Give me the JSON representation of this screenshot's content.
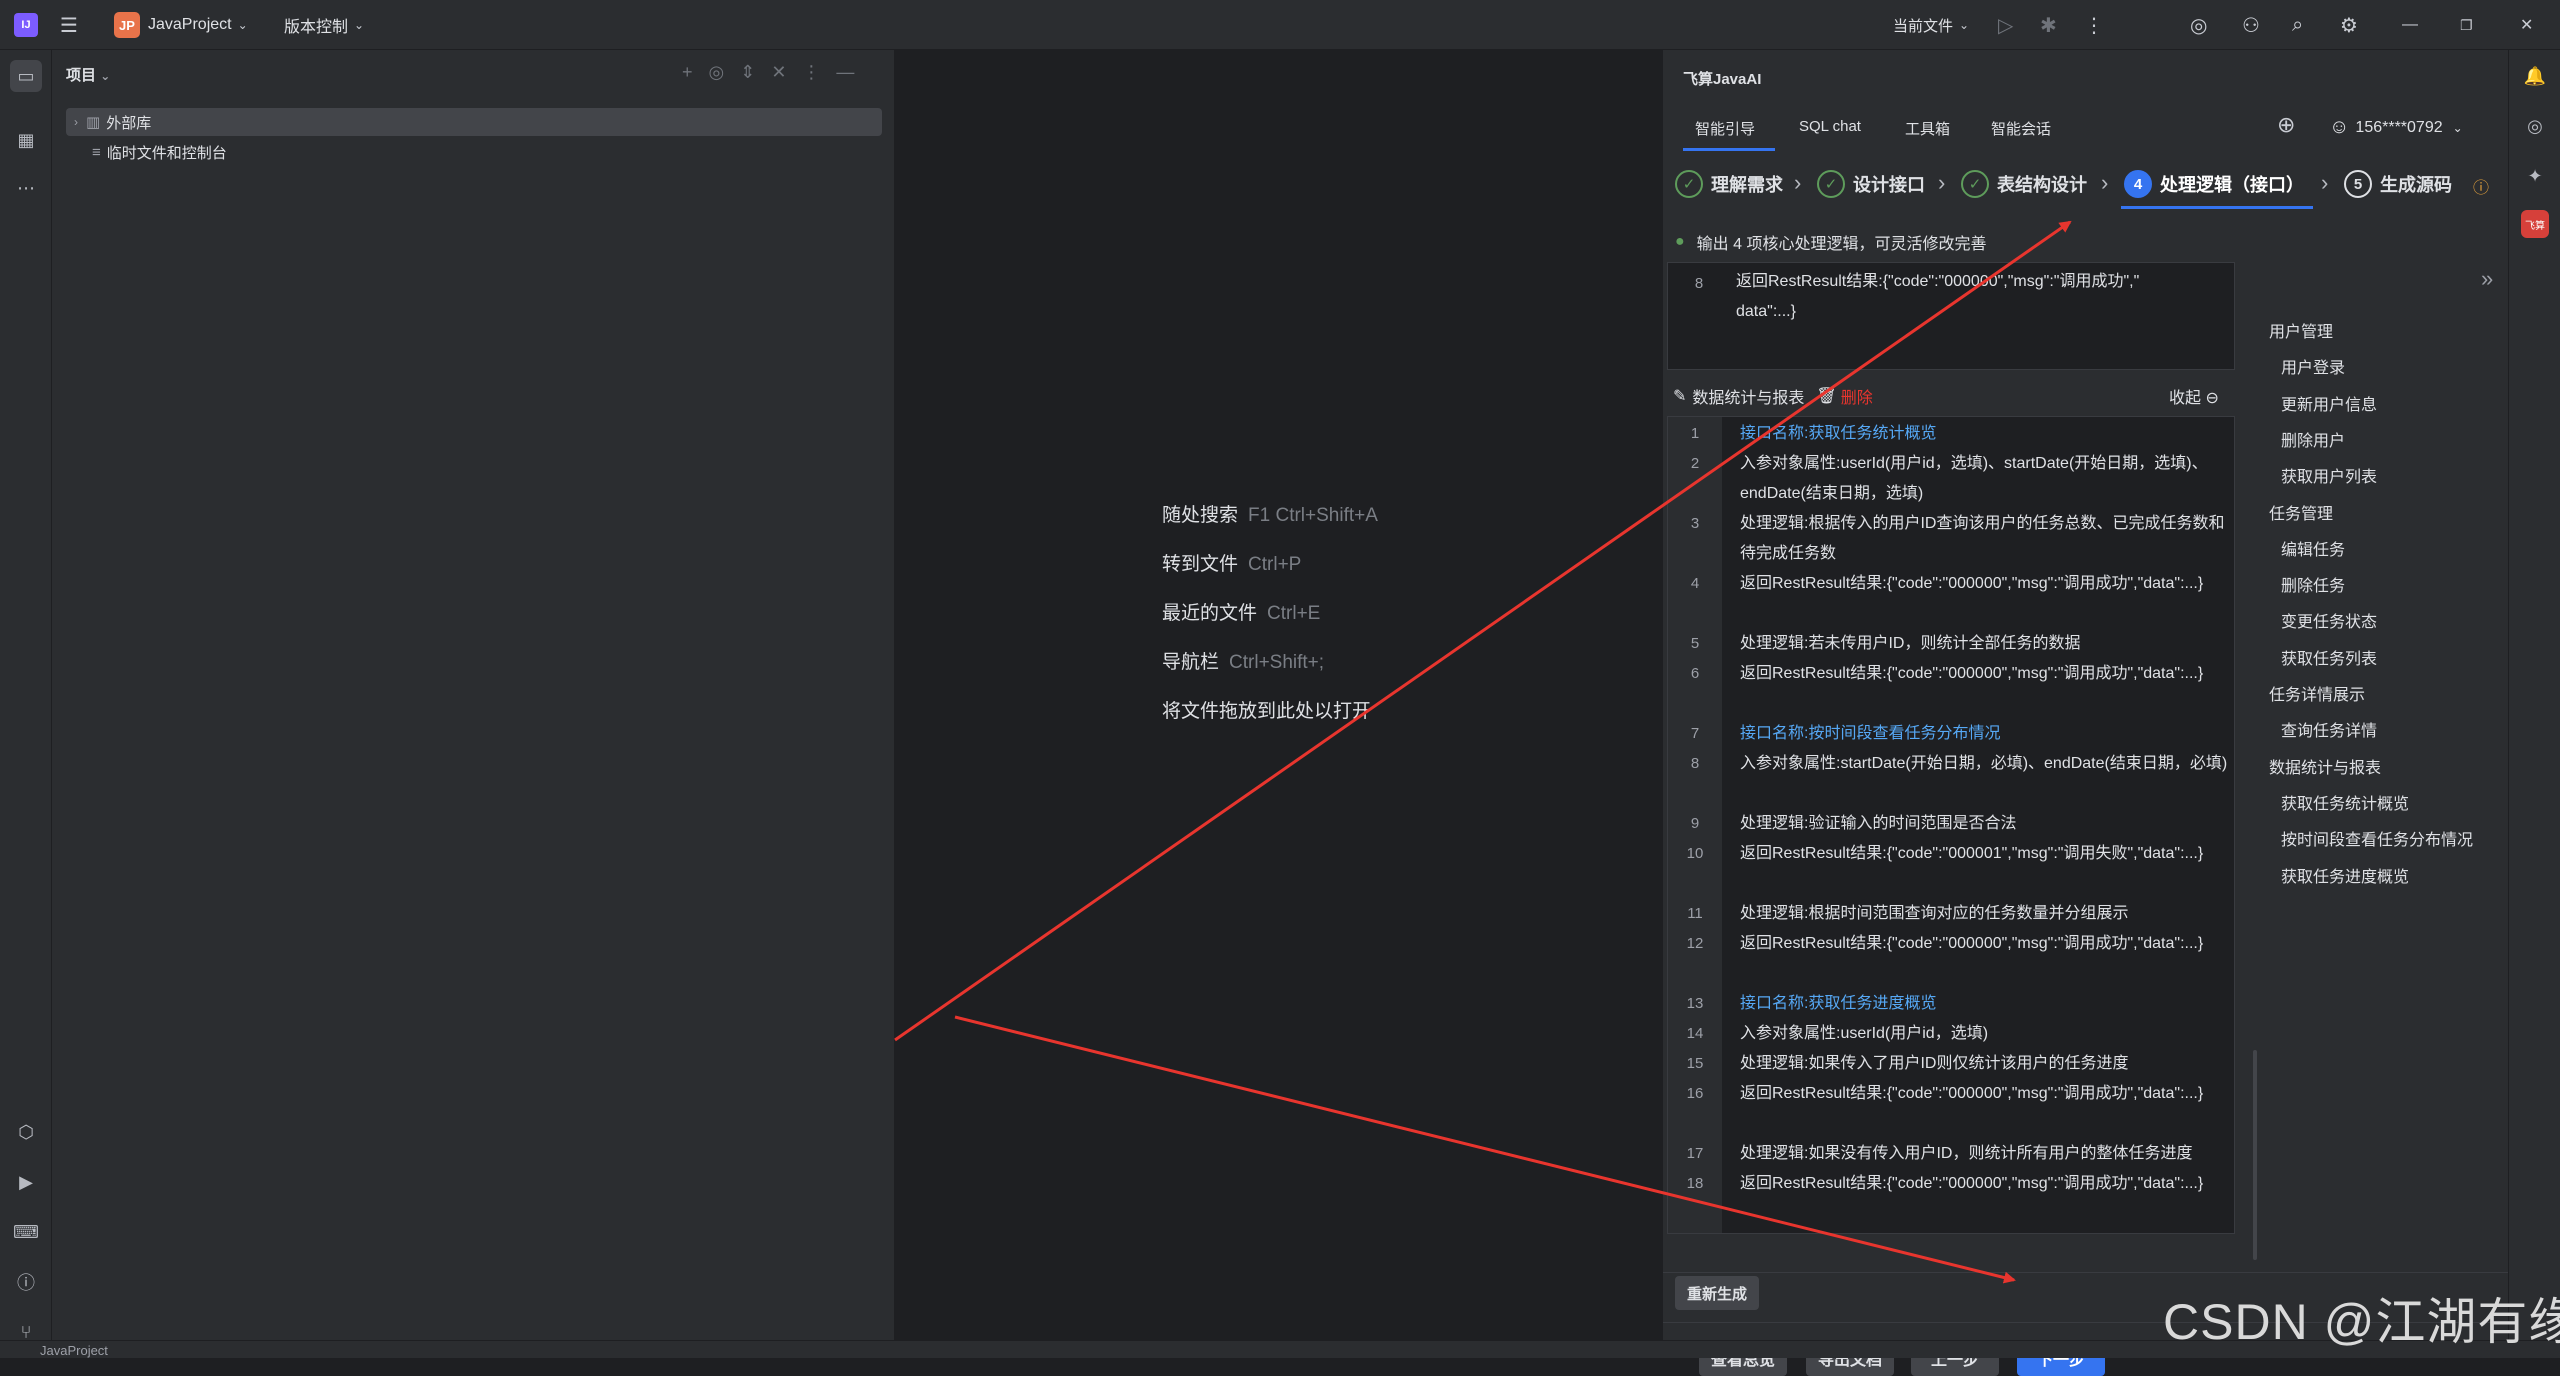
{
  "titlebar": {
    "logo": "IJ",
    "project_badge": "JP",
    "project_name": "JavaProject",
    "vcs_label": "版本控制",
    "run_config": "当前文件",
    "colors": {
      "badge": "#e8734a"
    }
  },
  "project_panel": {
    "title": "项目",
    "tree": [
      {
        "label": "外部库",
        "icon": "library-icon"
      },
      {
        "label": "临时文件和控制台",
        "icon": "scratch-icon"
      }
    ]
  },
  "editor": {
    "hints": [
      {
        "label": "随处搜索",
        "key": "F1 Ctrl+Shift+A"
      },
      {
        "label": "转到文件",
        "key": "Ctrl+P"
      },
      {
        "label": "最近的文件",
        "key": "Ctrl+E"
      },
      {
        "label": "导航栏",
        "key": "Ctrl+Shift+;"
      },
      {
        "label": "将文件拖放到此处以打开",
        "key": ""
      }
    ]
  },
  "plugin": {
    "title": "飞算JavaAI",
    "tabs": [
      "智能引导",
      "SQL chat",
      "工具箱",
      "智能会话"
    ],
    "account": "156****0792",
    "steps": [
      {
        "label": "理解需求",
        "state": "done"
      },
      {
        "label": "设计接口",
        "state": "done"
      },
      {
        "label": "表结构设计",
        "state": "done"
      },
      {
        "num": "4",
        "label": "处理逻辑（接口）",
        "state": "active"
      },
      {
        "num": "5",
        "label": "生成源码",
        "state": "todo"
      }
    ],
    "status_msg": "输出 4 项核心处理逻辑，可灵活修改完善",
    "prev_block": {
      "line_num": "8",
      "lines": [
        "返回RestResult结果:{\"code\":\"000000\",\"msg\":\"调用成功\",\"",
        "data\":...}"
      ]
    },
    "section": {
      "title": "数据统计与报表",
      "delete_label": "删除",
      "collapse_label": "收起"
    },
    "code_lines": [
      {
        "n": "1",
        "text": "接口名称:获取任务统计概览",
        "blue": true,
        "rows": 1
      },
      {
        "n": "2",
        "text": "入参对象属性:userId(用户id，选填)、startDate(开始日期，选填)、endDate(结束日期，选填)",
        "blue": false,
        "rows": 2
      },
      {
        "n": "3",
        "text": "处理逻辑:根据传入的用户ID查询该用户的任务总数、已完成任务数和待完成任务数",
        "blue": false,
        "rows": 2
      },
      {
        "n": "4",
        "text": "返回RestResult结果:{\"code\":\"000000\",\"msg\":\"调用成功\",\"data\":...}",
        "blue": false,
        "rows": 2
      },
      {
        "n": "5",
        "text": "处理逻辑:若未传用户ID，则统计全部任务的数据",
        "blue": false,
        "rows": 1
      },
      {
        "n": "6",
        "text": "返回RestResult结果:{\"code\":\"000000\",\"msg\":\"调用成功\",\"data\":...}",
        "blue": false,
        "rows": 2
      },
      {
        "n": "7",
        "text": "接口名称:按时间段查看任务分布情况",
        "blue": true,
        "rows": 1
      },
      {
        "n": "8",
        "text": "入参对象属性:startDate(开始日期，必填)、endDate(结束日期，必填)",
        "blue": false,
        "rows": 2
      },
      {
        "n": "9",
        "text": "处理逻辑:验证输入的时间范围是否合法",
        "blue": false,
        "rows": 1
      },
      {
        "n": "10",
        "text": "返回RestResult结果:{\"code\":\"000001\",\"msg\":\"调用失败\",\"data\":...}",
        "blue": false,
        "rows": 2
      },
      {
        "n": "11",
        "text": "处理逻辑:根据时间范围查询对应的任务数量并分组展示",
        "blue": false,
        "rows": 1
      },
      {
        "n": "12",
        "text": "返回RestResult结果:{\"code\":\"000000\",\"msg\":\"调用成功\",\"data\":...}",
        "blue": false,
        "rows": 2
      },
      {
        "n": "13",
        "text": "接口名称:获取任务进度概览",
        "blue": true,
        "rows": 1
      },
      {
        "n": "14",
        "text": "入参对象属性:userId(用户id，选填)",
        "blue": false,
        "rows": 1
      },
      {
        "n": "15",
        "text": "处理逻辑:如果传入了用户ID则仅统计该用户的任务进度",
        "blue": false,
        "rows": 1
      },
      {
        "n": "16",
        "text": "返回RestResult结果:{\"code\":\"000000\",\"msg\":\"调用成功\",\"data\":...}",
        "blue": false,
        "rows": 2
      },
      {
        "n": "17",
        "text": "处理逻辑:如果没有传入用户ID，则统计所有用户的整体任务进度",
        "blue": false,
        "rows": 1
      },
      {
        "n": "18",
        "text": "返回RestResult结果:{\"code\":\"000000\",\"msg\":\"调用成功\",\"data\":...}",
        "blue": false,
        "rows": 2
      }
    ],
    "outline": [
      {
        "type": "h",
        "label": "用户管理"
      },
      {
        "type": "i",
        "label": "用户登录"
      },
      {
        "type": "i",
        "label": "更新用户信息"
      },
      {
        "type": "i",
        "label": "删除用户"
      },
      {
        "type": "i",
        "label": "获取用户列表"
      },
      {
        "type": "h",
        "label": "任务管理"
      },
      {
        "type": "i",
        "label": "编辑任务"
      },
      {
        "type": "i",
        "label": "删除任务"
      },
      {
        "type": "i",
        "label": "变更任务状态"
      },
      {
        "type": "i",
        "label": "获取任务列表"
      },
      {
        "type": "h",
        "label": "任务详情展示"
      },
      {
        "type": "i",
        "label": "查询任务详情"
      },
      {
        "type": "h",
        "label": "数据统计与报表"
      },
      {
        "type": "i",
        "label": "获取任务统计概览"
      },
      {
        "type": "i",
        "label": "按时间段查看任务分布情况"
      },
      {
        "type": "i",
        "label": "获取任务进度概览"
      }
    ],
    "regenerate_label": "重新生成",
    "buttons": {
      "overview": "查看总览",
      "export": "导出文档",
      "prev": "上一步",
      "next": "下一步"
    }
  },
  "statusbar": {
    "project": "JavaProject"
  },
  "watermark": "CSDN @江湖有缘",
  "colors": {
    "accent": "#3574f0",
    "arrow": "#e8352e",
    "link": "#56a8f5",
    "done": "#5e9c5b"
  }
}
